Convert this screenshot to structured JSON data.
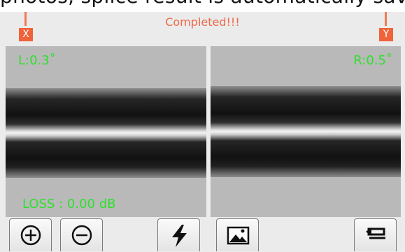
{
  "caption": {
    "text": "photos, splice result is automatically saved"
  },
  "header": {
    "status_text": "Completed!!!",
    "x_axis_label": "X",
    "y_axis_label": "Y"
  },
  "left_view": {
    "angle_text": "L:0.3˚",
    "loss_text": "LOSS : 0.00 dB"
  },
  "right_view": {
    "angle_text": "R:0.5˚"
  },
  "toolbar": {
    "buttons": [
      {
        "name": "zoom-in",
        "icon": "plus-circle-icon"
      },
      {
        "name": "zoom-out",
        "icon": "minus-circle-icon"
      },
      {
        "name": "arc",
        "icon": "lightning-icon"
      },
      {
        "name": "image",
        "icon": "picture-icon"
      },
      {
        "name": "back",
        "icon": "return-arrow-icon"
      }
    ]
  },
  "colors": {
    "status": "#ee6a48",
    "axis_marker": "#f0623a",
    "overlay_text": "#2fe02f",
    "background": "#ebebeb"
  }
}
